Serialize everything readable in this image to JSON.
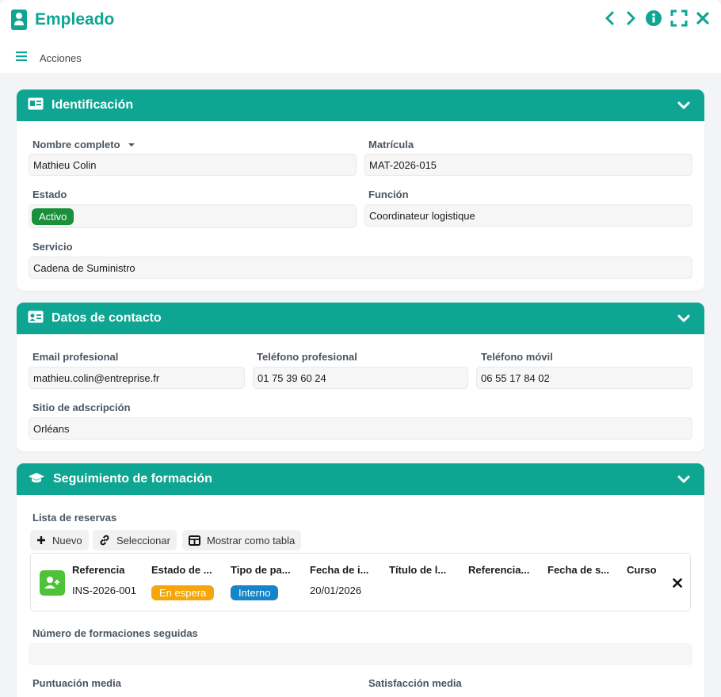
{
  "window": {
    "title": "Empleado",
    "actions_label": "Acciones"
  },
  "colors": {
    "accent": "#0fa593",
    "active": "#1a8f3c",
    "waiting": "#f5a60a",
    "internal": "#1584c8",
    "add": "#4ec238"
  },
  "identificacion": {
    "title": "Identificación",
    "nombre_label": "Nombre completo",
    "nombre": "Mathieu Colin",
    "matricula_label": "Matrícula",
    "matricula": "MAT-2026-015",
    "estado_label": "Estado",
    "estado": "Activo",
    "funcion_label": "Función",
    "funcion": "Coordinateur logistique",
    "servicio_label": "Servicio",
    "servicio": "Cadena de Suministro"
  },
  "contacto": {
    "title": "Datos de contacto",
    "email_label": "Email profesional",
    "email": "mathieu.colin@entreprise.fr",
    "tel_label": "Teléfono profesional",
    "tel": "01 75 39 60 24",
    "movil_label": "Teléfono móvil",
    "movil": "06 55 17 84 02",
    "sitio_label": "Sitio de adscripción",
    "sitio": "Orléans"
  },
  "formacion": {
    "title": "Seguimiento de formación",
    "lista_label": "Lista de reservas",
    "btn_nuevo": "Nuevo",
    "btn_seleccionar": "Seleccionar",
    "btn_tabla": "Mostrar como tabla",
    "columns": [
      "Referencia",
      "Estado de ...",
      "Tipo de pa...",
      "Fecha de i...",
      "Título de l...",
      "Referencia...",
      "Fecha de s...",
      "Curso"
    ],
    "row": {
      "referencia": "INS-2026-001",
      "estado": "En espera",
      "tipo": "Interno",
      "fecha": "20/01/2026"
    },
    "num_label": "Número de formaciones seguidas",
    "num_value": "",
    "puntuacion_label": "Puntuación media",
    "satisfaccion_label": "Satisfacción media"
  },
  "icons": [
    "id-badge-icon",
    "menu-icon",
    "chevron-left-icon",
    "chevron-right-icon",
    "info-icon",
    "fullscreen-icon",
    "close-icon",
    "id-card-icon",
    "contact-card-icon",
    "graduation-cap-icon",
    "chevron-down-icon",
    "plus-icon",
    "link-icon",
    "table-icon",
    "user-plus-icon",
    "remove-icon",
    "caret-down-icon"
  ]
}
